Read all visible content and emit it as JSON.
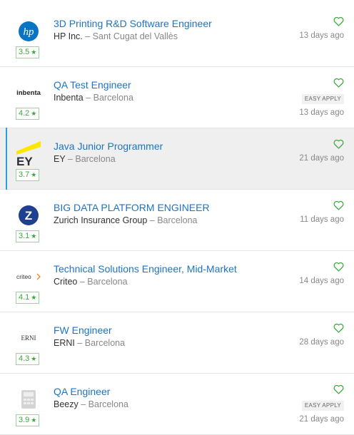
{
  "jobs": [
    {
      "title": "3D Printing R&D Software Engineer",
      "company": "HP Inc.",
      "location": "Sant Cugat del Vallès",
      "rating": "3.5",
      "posted": "13 days ago",
      "easy_apply": false,
      "logo": "hp-logo",
      "logo_text": "hp",
      "highlight": false
    },
    {
      "title": "QA Test Engineer",
      "company": "Inbenta",
      "location": "Barcelona",
      "rating": "4.2",
      "posted": "13 days ago",
      "easy_apply": true,
      "logo": "inbenta-logo",
      "logo_text": "inbenta",
      "highlight": false
    },
    {
      "title": "Java Junior Programmer",
      "company": "EY",
      "location": "Barcelona",
      "rating": "3.7",
      "posted": "21 days ago",
      "easy_apply": false,
      "logo": "ey-logo",
      "logo_text": "EY",
      "highlight": true
    },
    {
      "title": "BIG DATA PLATFORM ENGINEER",
      "company": "Zurich Insurance Group",
      "location": "Barcelona",
      "rating": "3.1",
      "posted": "11 days ago",
      "easy_apply": false,
      "logo": "zurich-logo",
      "logo_text": "Z",
      "highlight": false
    },
    {
      "title": "Technical Solutions Engineer, Mid-Market",
      "company": "Criteo",
      "location": "Barcelona",
      "rating": "4.1",
      "posted": "14 days ago",
      "easy_apply": false,
      "logo": "criteo-logo",
      "logo_text": "criteo",
      "highlight": false
    },
    {
      "title": "FW Engineer",
      "company": "ERNI",
      "location": "Barcelona",
      "rating": "4.3",
      "posted": "28 days ago",
      "easy_apply": false,
      "logo": "erni-logo",
      "logo_text": "ERNI",
      "highlight": false
    },
    {
      "title": "QA Engineer",
      "company": "Beezy",
      "location": "Barcelona",
      "rating": "3.9",
      "posted": "21 days ago",
      "easy_apply": true,
      "logo": "beezy-logo",
      "logo_text": "",
      "highlight": false
    }
  ],
  "labels": {
    "easy_apply": "EASY APPLY",
    "separator": " – ",
    "star": "★"
  },
  "colors": {
    "title_link": "#1f73c4",
    "rating_green": "#3aa83a",
    "highlight_bar": "#2a9fe0",
    "highlight_bg": "#efefef"
  }
}
